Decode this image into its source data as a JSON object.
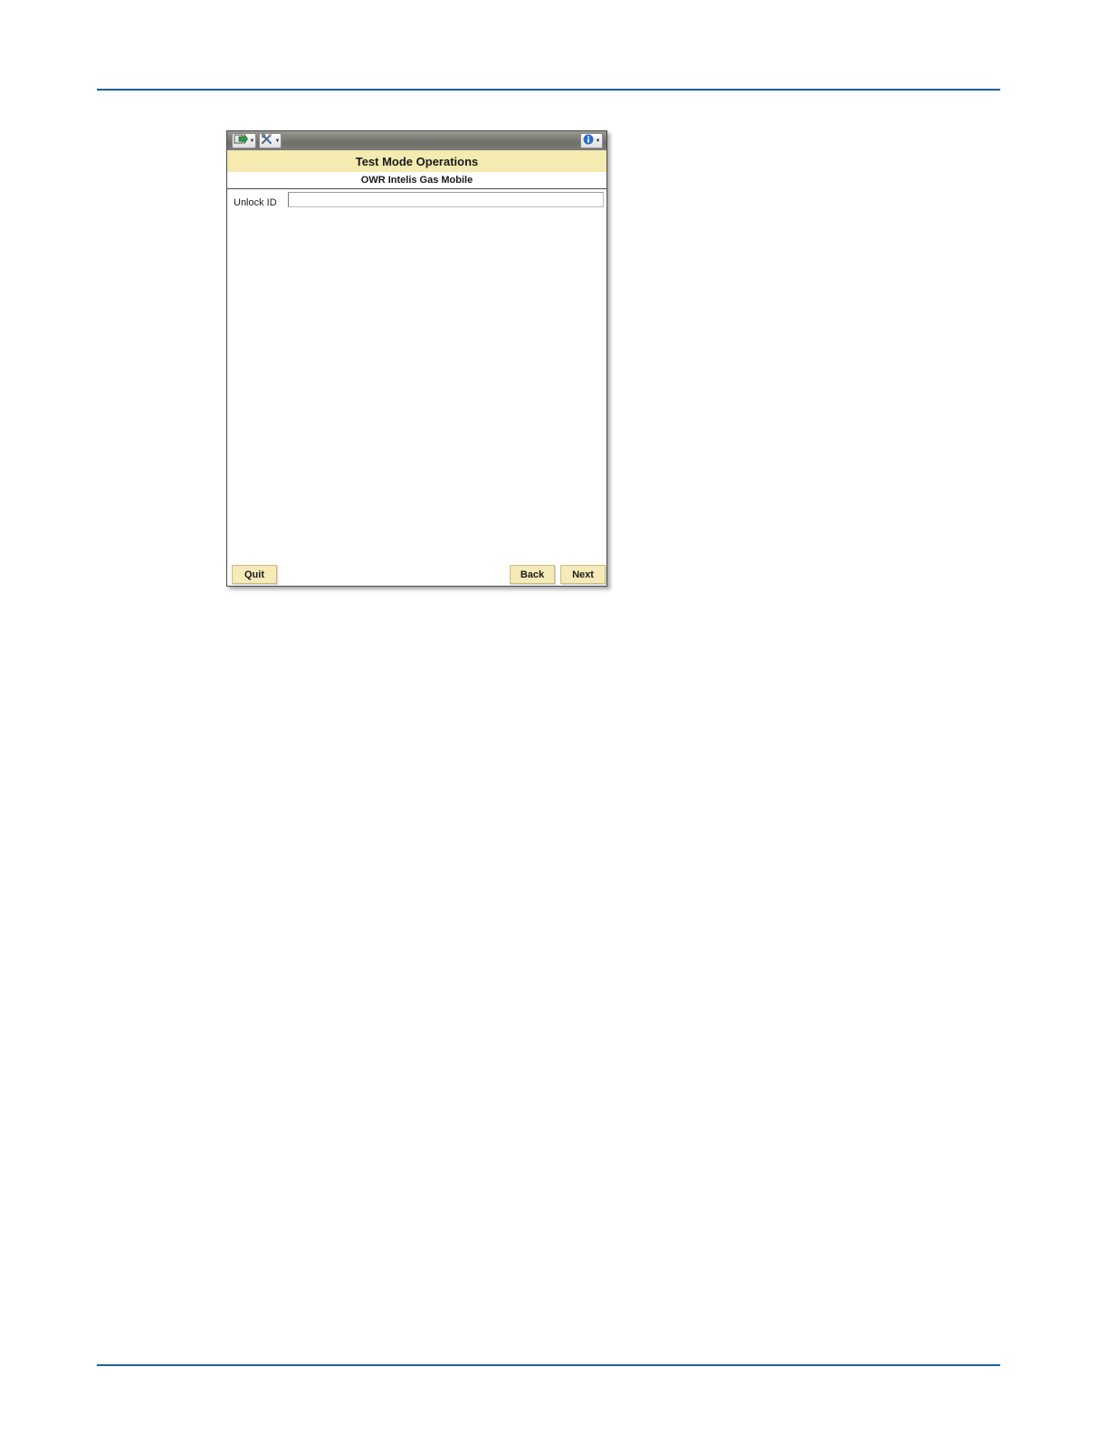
{
  "window": {
    "title": "Test Mode Operations",
    "subtitle": "OWR Intelis Gas Mobile"
  },
  "toolbar": {
    "icons": [
      "navigate-icon",
      "tools-icon",
      "info-icon"
    ],
    "accent": "#2a6fc9"
  },
  "form": {
    "unlock_label": "Unlock ID",
    "unlock_value": ""
  },
  "footer": {
    "quit_label": "Quit",
    "back_label": "Back",
    "next_label": "Next"
  },
  "colors": {
    "header_bg": "#f5eab0",
    "button_bg": "#f5eab8",
    "rule": "#1f5f99"
  }
}
